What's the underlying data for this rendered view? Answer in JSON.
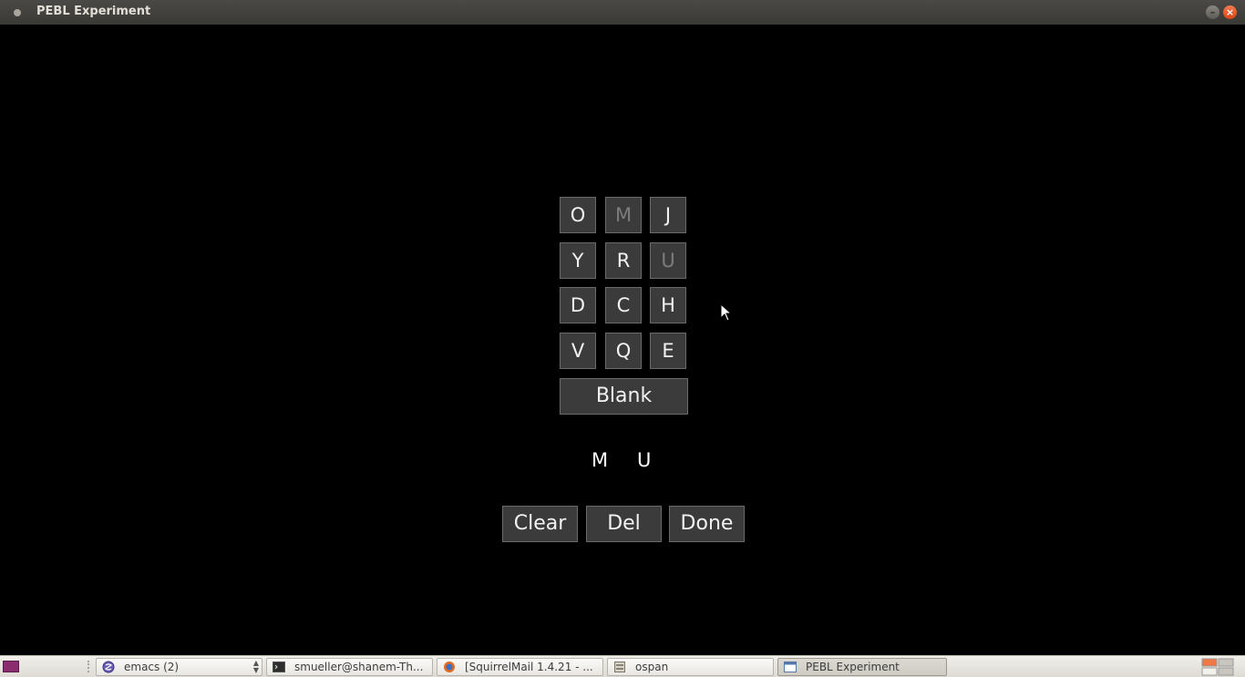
{
  "window": {
    "title": "PEBL Experiment",
    "minimize_glyph": "–",
    "close_glyph": "×"
  },
  "grid": {
    "keys": [
      {
        "label": "O",
        "disabled": false
      },
      {
        "label": "M",
        "disabled": true
      },
      {
        "label": "J",
        "disabled": false
      },
      {
        "label": "Y",
        "disabled": false
      },
      {
        "label": "R",
        "disabled": false
      },
      {
        "label": "U",
        "disabled": true
      },
      {
        "label": "D",
        "disabled": false
      },
      {
        "label": "C",
        "disabled": false
      },
      {
        "label": "H",
        "disabled": false
      },
      {
        "label": "V",
        "disabled": false
      },
      {
        "label": "Q",
        "disabled": false
      },
      {
        "label": "E",
        "disabled": false
      }
    ],
    "blank_label": "Blank"
  },
  "response": {
    "letters": [
      "M",
      "U"
    ]
  },
  "actions": {
    "clear_label": "Clear",
    "del_label": "Del",
    "done_label": "Done"
  },
  "taskbar": {
    "items": [
      {
        "label": "emacs (2)",
        "icon": "emacs-icon"
      },
      {
        "label": "smueller@shanem-Th...",
        "icon": "terminal-icon"
      },
      {
        "label": "[SquirrelMail 1.4.21 - ...",
        "icon": "firefox-icon"
      },
      {
        "label": "ospan",
        "icon": "file-manager-icon"
      },
      {
        "label": "PEBL Experiment",
        "icon": "window-icon"
      }
    ]
  },
  "colors": {
    "key_bg": "#3b3b3b",
    "key_text": "#f2f2f2",
    "key_disabled_text": "#7c7c7c",
    "background": "#000000"
  }
}
